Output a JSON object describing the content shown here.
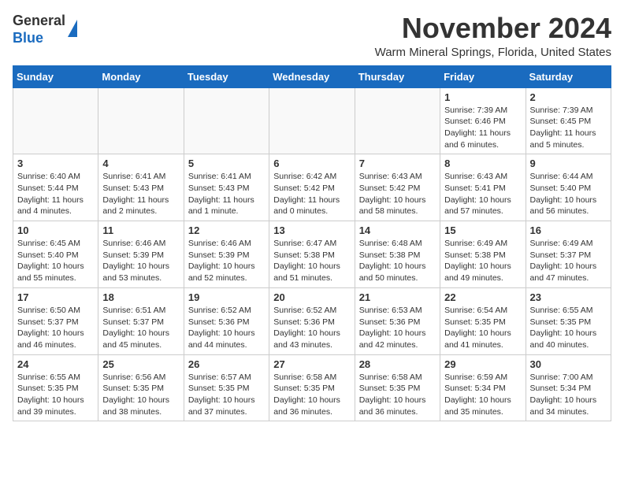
{
  "header": {
    "logo_general": "General",
    "logo_blue": "Blue",
    "month_title": "November 2024",
    "location": "Warm Mineral Springs, Florida, United States"
  },
  "days_of_week": [
    "Sunday",
    "Monday",
    "Tuesday",
    "Wednesday",
    "Thursday",
    "Friday",
    "Saturday"
  ],
  "weeks": [
    [
      {
        "day": "",
        "info": ""
      },
      {
        "day": "",
        "info": ""
      },
      {
        "day": "",
        "info": ""
      },
      {
        "day": "",
        "info": ""
      },
      {
        "day": "",
        "info": ""
      },
      {
        "day": "1",
        "info": "Sunrise: 7:39 AM\nSunset: 6:46 PM\nDaylight: 11 hours\nand 6 minutes."
      },
      {
        "day": "2",
        "info": "Sunrise: 7:39 AM\nSunset: 6:45 PM\nDaylight: 11 hours\nand 5 minutes."
      }
    ],
    [
      {
        "day": "3",
        "info": "Sunrise: 6:40 AM\nSunset: 5:44 PM\nDaylight: 11 hours\nand 4 minutes."
      },
      {
        "day": "4",
        "info": "Sunrise: 6:41 AM\nSunset: 5:43 PM\nDaylight: 11 hours\nand 2 minutes."
      },
      {
        "day": "5",
        "info": "Sunrise: 6:41 AM\nSunset: 5:43 PM\nDaylight: 11 hours\nand 1 minute."
      },
      {
        "day": "6",
        "info": "Sunrise: 6:42 AM\nSunset: 5:42 PM\nDaylight: 11 hours\nand 0 minutes."
      },
      {
        "day": "7",
        "info": "Sunrise: 6:43 AM\nSunset: 5:42 PM\nDaylight: 10 hours\nand 58 minutes."
      },
      {
        "day": "8",
        "info": "Sunrise: 6:43 AM\nSunset: 5:41 PM\nDaylight: 10 hours\nand 57 minutes."
      },
      {
        "day": "9",
        "info": "Sunrise: 6:44 AM\nSunset: 5:40 PM\nDaylight: 10 hours\nand 56 minutes."
      }
    ],
    [
      {
        "day": "10",
        "info": "Sunrise: 6:45 AM\nSunset: 5:40 PM\nDaylight: 10 hours\nand 55 minutes."
      },
      {
        "day": "11",
        "info": "Sunrise: 6:46 AM\nSunset: 5:39 PM\nDaylight: 10 hours\nand 53 minutes."
      },
      {
        "day": "12",
        "info": "Sunrise: 6:46 AM\nSunset: 5:39 PM\nDaylight: 10 hours\nand 52 minutes."
      },
      {
        "day": "13",
        "info": "Sunrise: 6:47 AM\nSunset: 5:38 PM\nDaylight: 10 hours\nand 51 minutes."
      },
      {
        "day": "14",
        "info": "Sunrise: 6:48 AM\nSunset: 5:38 PM\nDaylight: 10 hours\nand 50 minutes."
      },
      {
        "day": "15",
        "info": "Sunrise: 6:49 AM\nSunset: 5:38 PM\nDaylight: 10 hours\nand 49 minutes."
      },
      {
        "day": "16",
        "info": "Sunrise: 6:49 AM\nSunset: 5:37 PM\nDaylight: 10 hours\nand 47 minutes."
      }
    ],
    [
      {
        "day": "17",
        "info": "Sunrise: 6:50 AM\nSunset: 5:37 PM\nDaylight: 10 hours\nand 46 minutes."
      },
      {
        "day": "18",
        "info": "Sunrise: 6:51 AM\nSunset: 5:37 PM\nDaylight: 10 hours\nand 45 minutes."
      },
      {
        "day": "19",
        "info": "Sunrise: 6:52 AM\nSunset: 5:36 PM\nDaylight: 10 hours\nand 44 minutes."
      },
      {
        "day": "20",
        "info": "Sunrise: 6:52 AM\nSunset: 5:36 PM\nDaylight: 10 hours\nand 43 minutes."
      },
      {
        "day": "21",
        "info": "Sunrise: 6:53 AM\nSunset: 5:36 PM\nDaylight: 10 hours\nand 42 minutes."
      },
      {
        "day": "22",
        "info": "Sunrise: 6:54 AM\nSunset: 5:35 PM\nDaylight: 10 hours\nand 41 minutes."
      },
      {
        "day": "23",
        "info": "Sunrise: 6:55 AM\nSunset: 5:35 PM\nDaylight: 10 hours\nand 40 minutes."
      }
    ],
    [
      {
        "day": "24",
        "info": "Sunrise: 6:55 AM\nSunset: 5:35 PM\nDaylight: 10 hours\nand 39 minutes."
      },
      {
        "day": "25",
        "info": "Sunrise: 6:56 AM\nSunset: 5:35 PM\nDaylight: 10 hours\nand 38 minutes."
      },
      {
        "day": "26",
        "info": "Sunrise: 6:57 AM\nSunset: 5:35 PM\nDaylight: 10 hours\nand 37 minutes."
      },
      {
        "day": "27",
        "info": "Sunrise: 6:58 AM\nSunset: 5:35 PM\nDaylight: 10 hours\nand 36 minutes."
      },
      {
        "day": "28",
        "info": "Sunrise: 6:58 AM\nSunset: 5:35 PM\nDaylight: 10 hours\nand 36 minutes."
      },
      {
        "day": "29",
        "info": "Sunrise: 6:59 AM\nSunset: 5:34 PM\nDaylight: 10 hours\nand 35 minutes."
      },
      {
        "day": "30",
        "info": "Sunrise: 7:00 AM\nSunset: 5:34 PM\nDaylight: 10 hours\nand 34 minutes."
      }
    ]
  ]
}
